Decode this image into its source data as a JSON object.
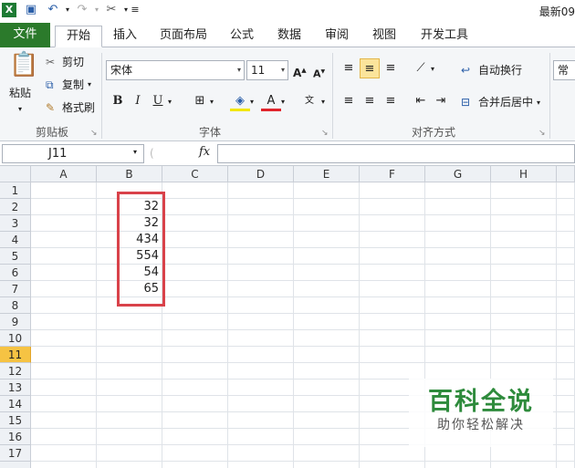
{
  "qat": {
    "title": "最新09"
  },
  "tabs": [
    {
      "label": "文件"
    },
    {
      "label": "开始"
    },
    {
      "label": "插入"
    },
    {
      "label": "页面布局"
    },
    {
      "label": "公式"
    },
    {
      "label": "数据"
    },
    {
      "label": "审阅"
    },
    {
      "label": "视图"
    },
    {
      "label": "开发工具"
    }
  ],
  "clipboard": {
    "paste": "粘贴",
    "cut": "剪切",
    "copy": "复制",
    "format_painter": "格式刷",
    "group": "剪贴板"
  },
  "font": {
    "name": "宋体",
    "size": "11",
    "bold": "B",
    "italic": "I",
    "underline": "U",
    "group": "字体"
  },
  "alignment": {
    "wrap": "自动换行",
    "merge": "合并后居中",
    "group": "对齐方式"
  },
  "number": {
    "format": "常规"
  },
  "formula_bar": {
    "name_box": "J11",
    "fx": "fx",
    "formula": ""
  },
  "columns": [
    "A",
    "B",
    "C",
    "D",
    "E",
    "F",
    "G",
    "H"
  ],
  "rows": [
    "1",
    "2",
    "3",
    "4",
    "5",
    "6",
    "7",
    "8",
    "9",
    "10",
    "11",
    "12",
    "13",
    "14",
    "15",
    "16",
    "17"
  ],
  "selected_row": "11",
  "column_b_values": [
    "",
    "32",
    "32",
    "434",
    "554",
    "54",
    "65"
  ],
  "watermark": {
    "title": "百科全说",
    "subtitle": "助你轻松解决"
  },
  "colors": {
    "file_tab": "#2b7a2b",
    "highlight_box": "#d9424a",
    "selected_row": "#f6c343"
  }
}
